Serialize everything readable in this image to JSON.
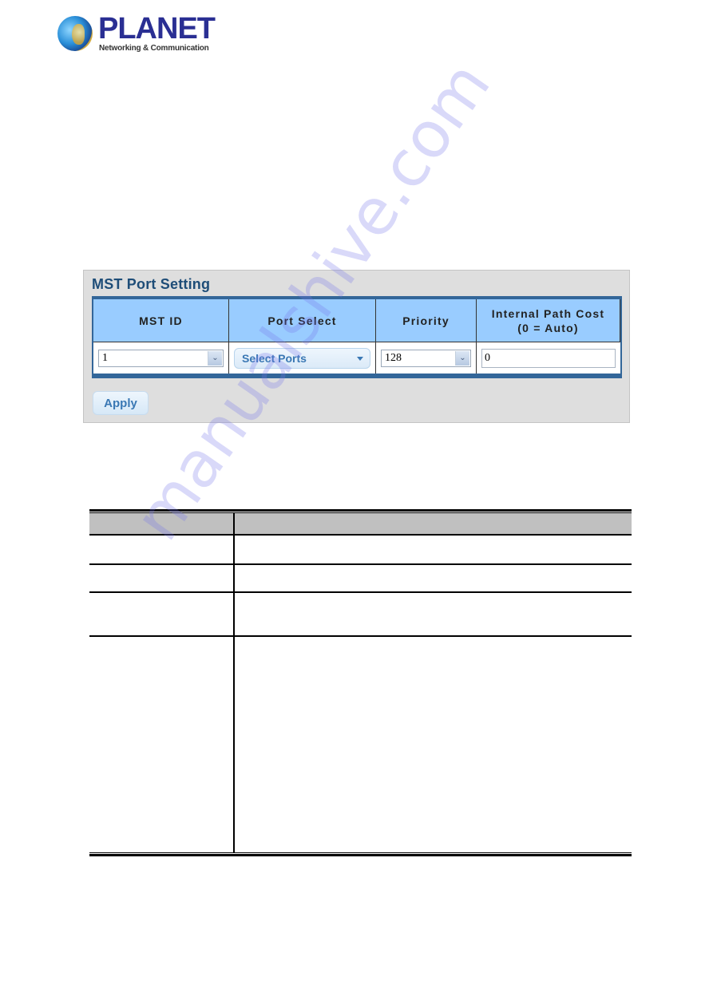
{
  "logo": {
    "name": "PLANET",
    "tagline": "Networking & Communication",
    "colors": {
      "name": "#2a2f93",
      "globe": "#2a8fd8",
      "ring": "#d3a637"
    }
  },
  "panel": {
    "title": "MST Port Setting",
    "columns": [
      {
        "label": "MST ID"
      },
      {
        "label": "Port Select"
      },
      {
        "label": "Priority"
      },
      {
        "label": "Internal Path Cost",
        "sublabel": "(0 = Auto)"
      }
    ],
    "row": {
      "mst_id": {
        "value": "1"
      },
      "port_select": {
        "value": "Select Ports"
      },
      "priority": {
        "value": "128"
      },
      "internal_path_cost": {
        "value": "0"
      }
    },
    "apply_label": "Apply",
    "colors": {
      "header_bg": "#99ccff",
      "border": "#336699",
      "title": "#1e4d78",
      "panel_bg": "#dedede",
      "button_text": "#3a78b4"
    }
  },
  "doc_table": {
    "header": [
      "",
      ""
    ],
    "rows": [
      [
        "",
        ""
      ],
      [
        "",
        ""
      ],
      [
        "",
        ""
      ],
      [
        "",
        ""
      ]
    ]
  },
  "watermark": {
    "text": "manualshive.com"
  }
}
